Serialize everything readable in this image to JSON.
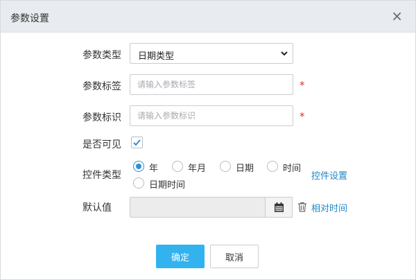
{
  "dialog": {
    "title": "参数设置",
    "close_glyph": "×"
  },
  "form": {
    "param_type": {
      "label": "参数类型",
      "value": "日期类型"
    },
    "param_tag": {
      "label": "参数标签",
      "placeholder": "请输入参数标签",
      "required_mark": "*"
    },
    "param_id": {
      "label": "参数标识",
      "placeholder": "请输入参数标识",
      "required_mark": "*"
    },
    "visible": {
      "label": "是否可见",
      "checked": true
    },
    "control_type": {
      "label": "控件类型",
      "options": [
        "年",
        "年月",
        "日期",
        "时间",
        "日期时间"
      ],
      "selected": "年",
      "settings_link": "控件设置"
    },
    "default_value": {
      "label": "默认值",
      "value": "",
      "relative_link": "相对时间"
    }
  },
  "buttons": {
    "confirm": "确定",
    "cancel": "取消"
  },
  "colors": {
    "accent": "#33b2f0",
    "link": "#1e88c9",
    "required": "#e03030",
    "header_bg": "#e8ebef"
  }
}
